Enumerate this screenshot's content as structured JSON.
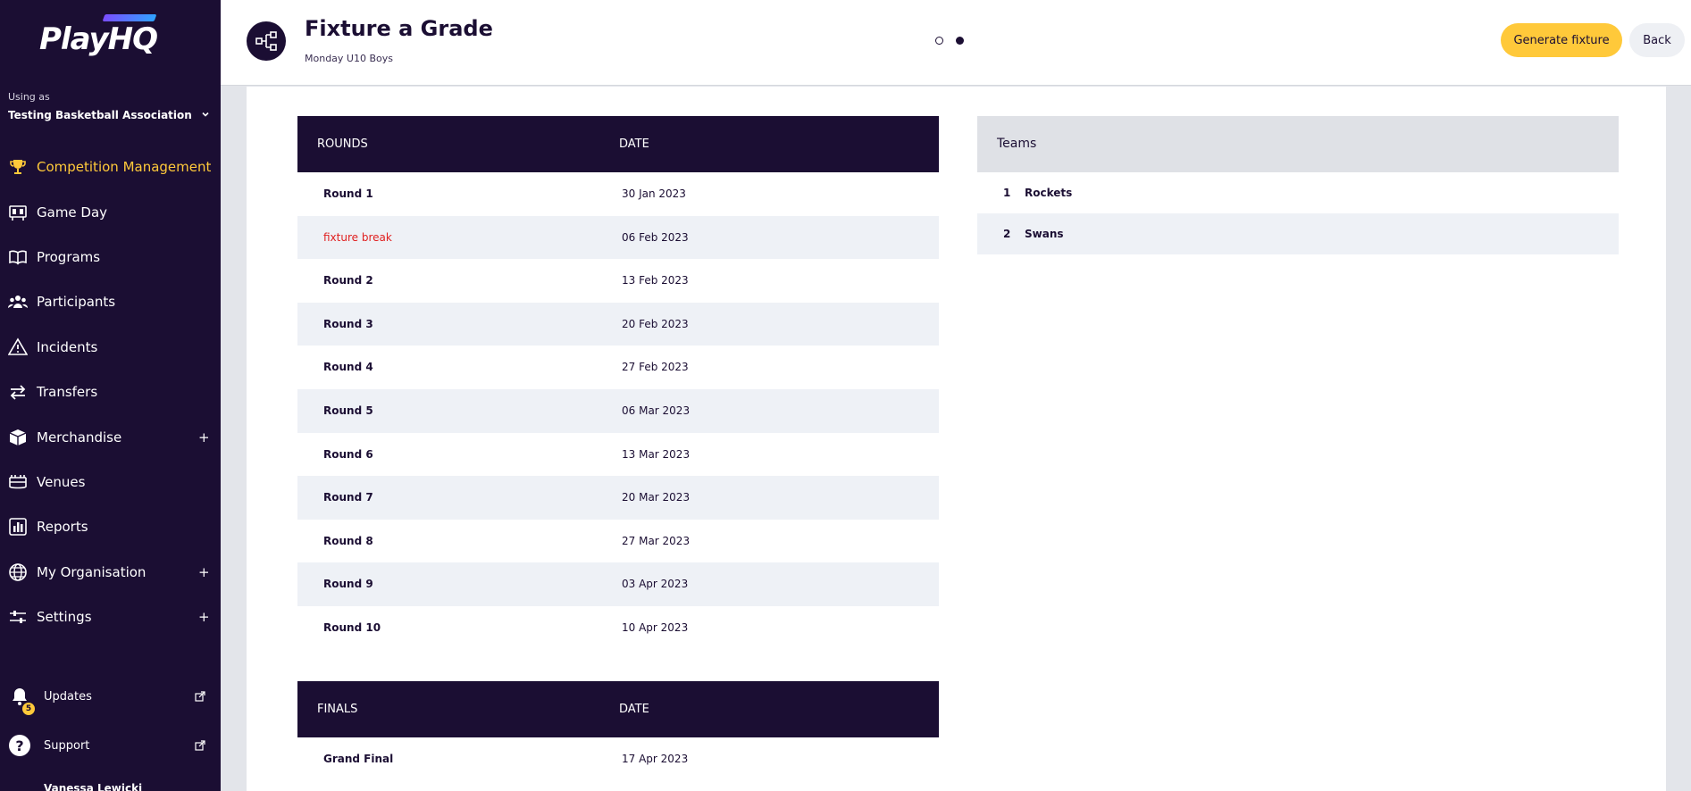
{
  "sidebar": {
    "logo": {
      "play": "Play",
      "hq": "HQ"
    },
    "using_as": "Using as",
    "org_name": "Testing Basketball Association",
    "nav": [
      {
        "label": "Competition Management",
        "icon": "trophy-icon",
        "active": true
      },
      {
        "label": "Game Day",
        "icon": "scoreboard-icon"
      },
      {
        "label": "Programs",
        "icon": "book-icon"
      },
      {
        "label": "Participants",
        "icon": "people-icon"
      },
      {
        "label": "Incidents",
        "icon": "warning-icon"
      },
      {
        "label": "Transfers",
        "icon": "transfer-arrows-icon"
      },
      {
        "label": "Merchandise",
        "icon": "box-icon",
        "expandable": true
      },
      {
        "label": "Venues",
        "icon": "stadium-icon"
      },
      {
        "label": "Reports",
        "icon": "bar-chart-icon"
      },
      {
        "label": "My Organisation",
        "icon": "globe-icon",
        "expandable": true
      },
      {
        "label": "Settings",
        "icon": "sliders-icon",
        "expandable": true
      }
    ],
    "plus": "+",
    "updates": {
      "label": "Updates",
      "badge": "5"
    },
    "support": {
      "label": "Support"
    },
    "user_name": "Vanessa Lewicki"
  },
  "header": {
    "title": "Fixture a Grade",
    "subtitle": "Monday U10 Boys",
    "generate_label": "Generate fixture",
    "back_label": "Back"
  },
  "rounds_table": {
    "headers": [
      "ROUNDS",
      "DATE"
    ],
    "rows": [
      {
        "name": "Round 1",
        "date": "30 Jan 2023"
      },
      {
        "name": "fixture break",
        "date": "06 Feb 2023",
        "is_break": true
      },
      {
        "name": "Round 2",
        "date": "13 Feb 2023"
      },
      {
        "name": "Round 3",
        "date": "20 Feb 2023"
      },
      {
        "name": "Round 4",
        "date": "27 Feb 2023"
      },
      {
        "name": "Round 5",
        "date": "06 Mar 2023"
      },
      {
        "name": "Round 6",
        "date": "13 Mar 2023"
      },
      {
        "name": "Round 7",
        "date": "20 Mar 2023"
      },
      {
        "name": "Round 8",
        "date": "27 Mar 2023"
      },
      {
        "name": "Round 9",
        "date": "03 Apr 2023"
      },
      {
        "name": "Round 10",
        "date": "10 Apr 2023"
      }
    ]
  },
  "finals_table": {
    "headers": [
      "FINALS",
      "DATE"
    ],
    "rows": [
      {
        "name": "Grand Final",
        "date": "17 Apr 2023"
      }
    ]
  },
  "teams_table": {
    "header": "Teams",
    "rows": [
      {
        "num": "1",
        "name": "Rockets"
      },
      {
        "num": "2",
        "name": "Swans"
      }
    ]
  },
  "colors": {
    "brand_dark": "#1b0e33",
    "accent": "#ffc93a",
    "break_red": "#e02020"
  }
}
